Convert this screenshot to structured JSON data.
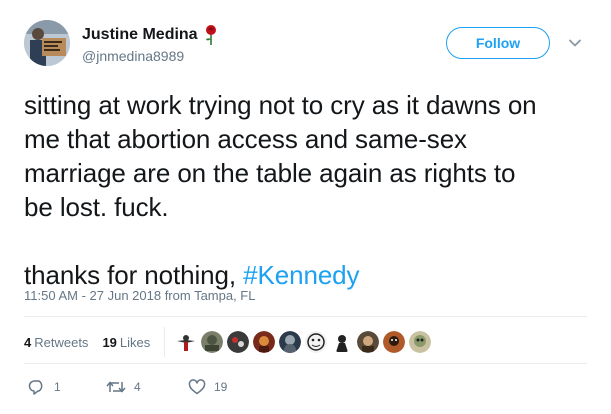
{
  "author": {
    "display_name": "Justine Medina",
    "handle": "@jnmedina8989",
    "name_emoji": "rose-icon"
  },
  "header": {
    "follow_label": "Follow",
    "menu_icon": "chevron-down-icon"
  },
  "tweet": {
    "lines": [
      "sitting at work trying not to cry as it dawns on",
      "me that abortion access and same-sex",
      "marriage are on the table again as rights to",
      "be lost. fuck."
    ],
    "second_paragraph_prefix": "thanks for nothing, ",
    "hashtag": "#Kennedy",
    "timestamp": "11:50 AM - 27 Jun 2018 from Tampa, FL"
  },
  "stats": {
    "retweets_count": "4",
    "retweets_label": "Retweets",
    "likes_count": "19",
    "likes_label": "Likes",
    "liker_avatars": 10
  },
  "actions": {
    "reply_count": "1",
    "retweet_count": "4",
    "like_count": "19"
  },
  "colors": {
    "accent": "#1da1f2",
    "secondary_text": "#657786",
    "primary_text": "#14171a",
    "divider": "#e6ecf0",
    "rose": "#c0101a"
  }
}
